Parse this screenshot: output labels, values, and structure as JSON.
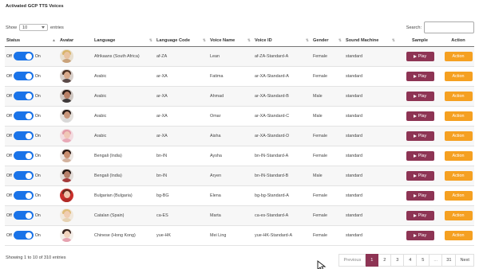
{
  "title": "Activated GCP TTS Voices",
  "length_menu": {
    "prefix": "Show",
    "value": "10",
    "suffix": "entries"
  },
  "search": {
    "label": "Search:",
    "value": ""
  },
  "columns": [
    "Status",
    "Avatar",
    "Language",
    "Language Code",
    "Voice Name",
    "Voice ID",
    "Gender",
    "Sound Machine",
    "Sample",
    "Action"
  ],
  "toggle_labels": {
    "off": "Off",
    "on": "On"
  },
  "play_label": "Play",
  "action_label": "Action",
  "rows": [
    {
      "language": "Afrikaans (South Africa)",
      "code": "af-ZA",
      "name": "Lean",
      "voice_id": "af-ZA-Standard-A",
      "gender": "Female",
      "machine": "standard",
      "avatar": {
        "skin": "#e9c3a0",
        "hair": "#d8b46a",
        "bg": "#e8dfcf",
        "shirt": "#c9a27a"
      }
    },
    {
      "language": "Arabic",
      "code": "ar-XA",
      "name": "Fatima",
      "voice_id": "ar-XA-Standard-A",
      "gender": "Female",
      "machine": "standard",
      "avatar": {
        "skin": "#d9a98a",
        "hair": "#4a3022",
        "bg": "#d8d0cb",
        "shirt": "#5b4a48"
      }
    },
    {
      "language": "Arabic",
      "code": "ar-XA",
      "name": "Ahmad",
      "voice_id": "ar-XA-Standard-B",
      "gender": "Male",
      "machine": "standard",
      "avatar": {
        "skin": "#b98066",
        "hair": "#2b1c16",
        "bg": "#cfc7c2",
        "shirt": "#3f3a3a"
      }
    },
    {
      "language": "Arabic",
      "code": "ar-XA",
      "name": "Omar",
      "voice_id": "ar-XA-Standard-C",
      "gender": "Male",
      "machine": "standard",
      "avatar": {
        "skin": "#c9967a",
        "hair": "#2a1d18",
        "bg": "#e4e0dc",
        "shirt": "#d8d8d8"
      }
    },
    {
      "language": "Arabic",
      "code": "ar-XA",
      "name": "Aisha",
      "voice_id": "ar-XA-Standard-D",
      "gender": "Female",
      "machine": "standard",
      "avatar": {
        "skin": "#f0c7b6",
        "hair": "#e29aa6",
        "bg": "#f3dbe0",
        "shirt": "#e8a9b7"
      }
    },
    {
      "language": "Bengali (India)",
      "code": "bn-IN",
      "name": "Aysha",
      "voice_id": "bn-IN-Standard-A",
      "gender": "Female",
      "machine": "standard",
      "avatar": {
        "skin": "#c98e6f",
        "hair": "#2b1a14",
        "bg": "#ece6e2",
        "shirt": "#d3b29e"
      }
    },
    {
      "language": "Bengali (India)",
      "code": "bn-IN",
      "name": "Aryen",
      "voice_id": "bn-IN-Standard-B",
      "gender": "Male",
      "machine": "standard",
      "avatar": {
        "skin": "#b7806a",
        "hair": "#251712",
        "bg": "#e2dcd8",
        "shirt": "#a43a3a"
      }
    },
    {
      "language": "Bulgarian (Bulgaria)",
      "code": "bg-BG",
      "name": "Elena",
      "voice_id": "bg-bg-Standard-A",
      "gender": "Female",
      "machine": "standard",
      "avatar": {
        "skin": "#efc5ac",
        "hair": "#6a2a1e",
        "bg": "#c9302c",
        "shirt": "#b02a26"
      }
    },
    {
      "language": "Catalan (Spain)",
      "code": "ca-ES",
      "name": "Marta",
      "voice_id": "ca-es-Standard-A",
      "gender": "Female",
      "machine": "standard",
      "avatar": {
        "skin": "#f0cdb2",
        "hair": "#e0bc7a",
        "bg": "#f1e8dc",
        "shirt": "#e6d2b2"
      }
    },
    {
      "language": "Chinese (Hong Kong)",
      "code": "yue-HK",
      "name": "Mei Ling",
      "voice_id": "yue-HK-Standard-A",
      "gender": "Female",
      "machine": "standard",
      "avatar": {
        "skin": "#f2d3bd",
        "hair": "#3a2520",
        "bg": "#f4eee9",
        "shirt": "#e6a2b0"
      }
    }
  ],
  "info": "Showing 1 to 10 of 310 entries",
  "pagination": [
    "Previous",
    "1",
    "2",
    "3",
    "4",
    "5",
    "...",
    "31",
    "Next"
  ],
  "pagination_active": "1",
  "colors": {
    "toggle_on": "#1a73e8",
    "play": "#8e3454",
    "action": "#f5a021",
    "page_active": "#8e3454"
  }
}
